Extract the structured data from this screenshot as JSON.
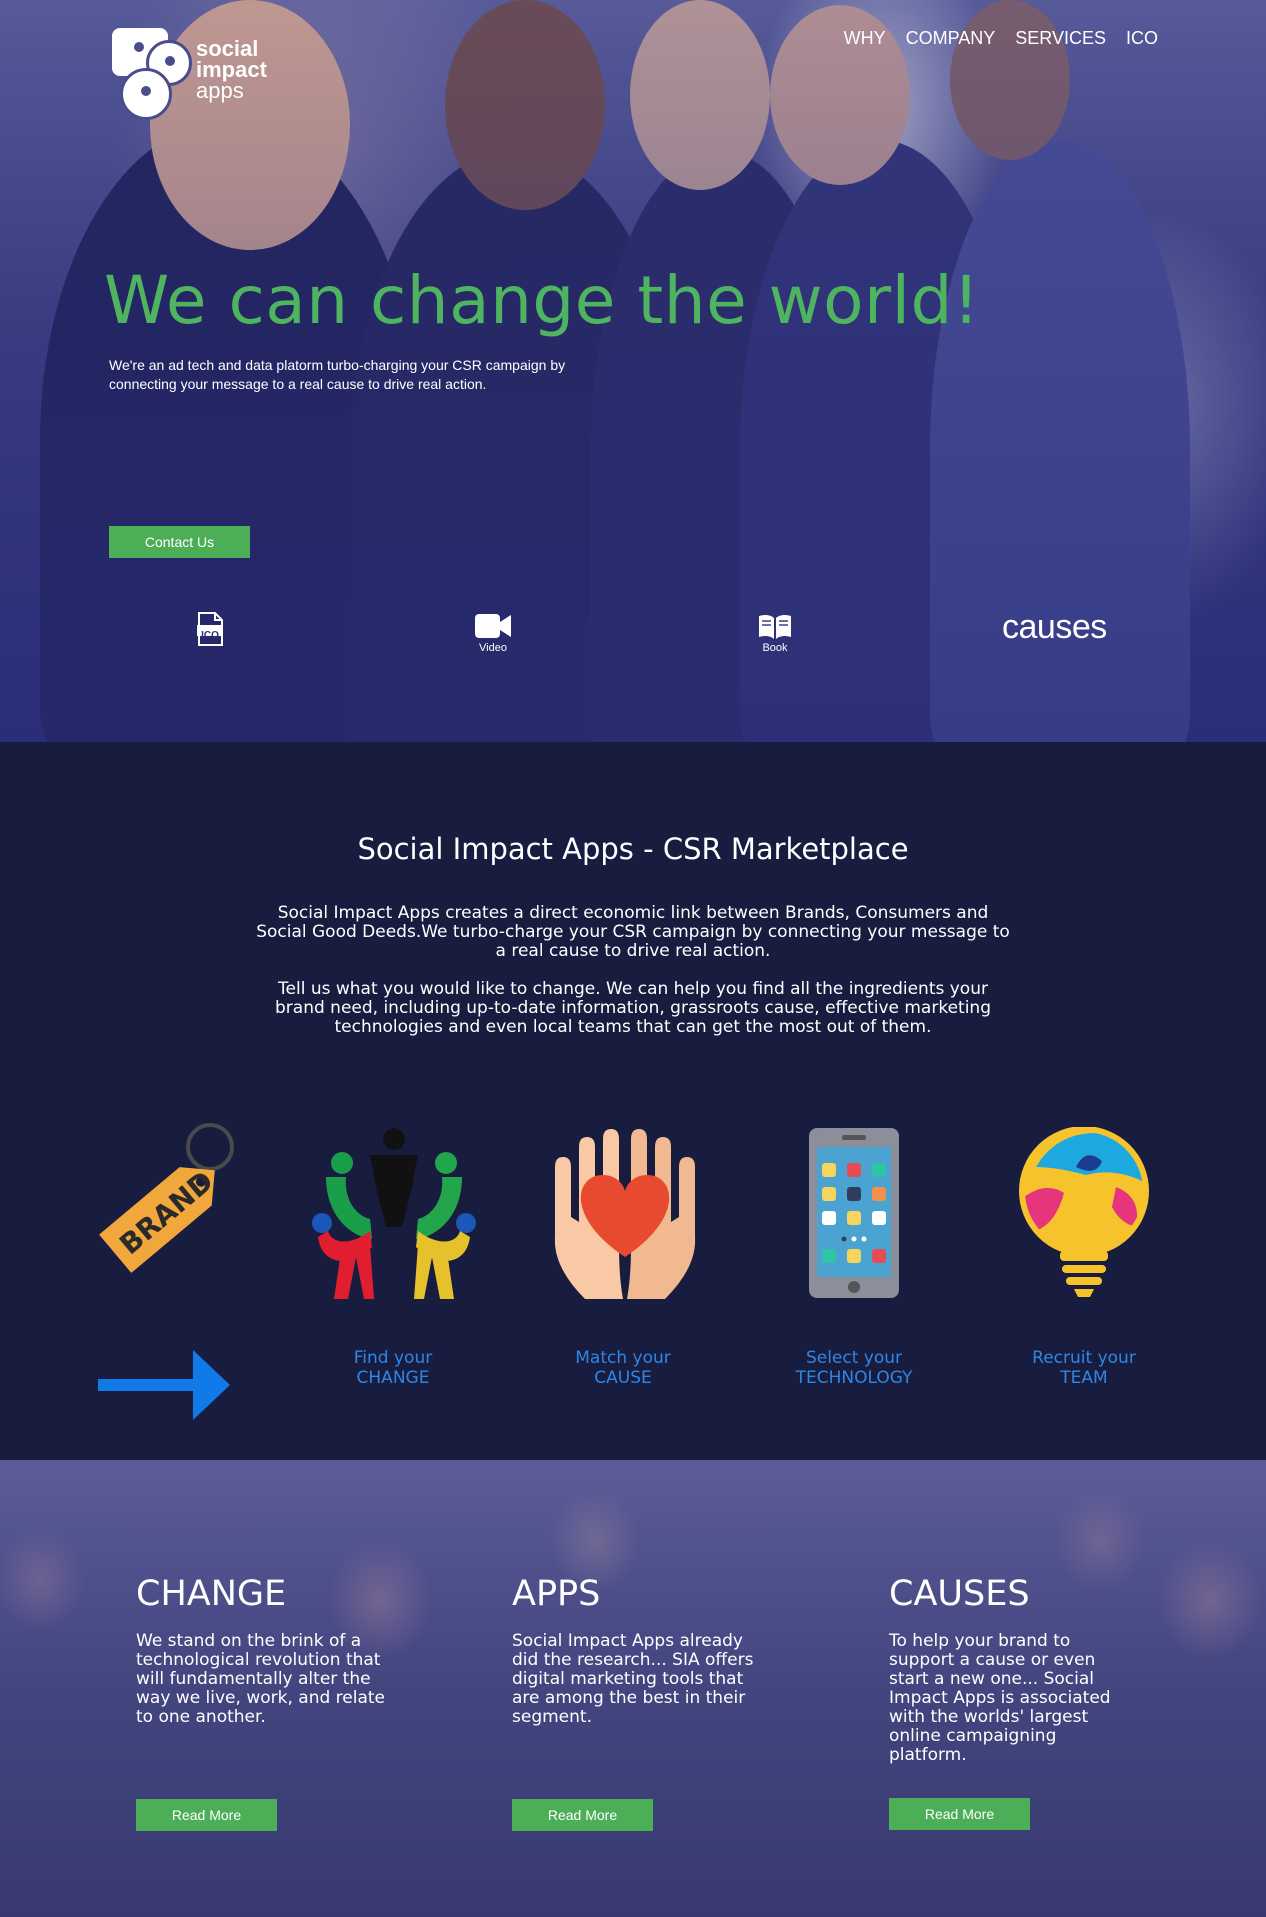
{
  "logo": {
    "line1": "social",
    "line2": "impact",
    "line3": "apps"
  },
  "nav": {
    "items": [
      "WHY",
      "COMPANY",
      "SERVICES",
      "ICO"
    ]
  },
  "hero": {
    "title": "We can change the world!",
    "lead": "We're an ad tech and data platorm turbo-charging your CSR campaign by connecting your message to a real cause to drive real action.",
    "contact_label": "Contact Us",
    "quick": {
      "ico_label": "ICO",
      "video_label": "Video",
      "book_label": "Book",
      "causes_word": "causes"
    }
  },
  "market": {
    "title": "Social Impact Apps - CSR Marketplace",
    "p1": "Social Impact Apps creates a direct economic link between Brands, Consumers and Social Good Deeds.We turbo-charge your CSR campaign by connecting your message to a real cause to drive real action.",
    "p2": "Tell us what you would like to change. We can help you find all the ingredients your brand need, including up-to-date information, grassroots cause, effective marketing technologies and even local teams that can get the most out of them.",
    "brand_tag": "BRAND",
    "steps": [
      {
        "line1": "Find your",
        "line2": "CHANGE",
        "icon": "people-circle-icon"
      },
      {
        "line1": "Match your",
        "line2": "CAUSE",
        "icon": "hands-heart-icon"
      },
      {
        "line1": "Select your",
        "line2": "TECHNOLOGY",
        "icon": "smartphone-icon"
      },
      {
        "line1": "Recruit your",
        "line2": "TEAM",
        "icon": "lightbulb-icon"
      }
    ],
    "colors": {
      "accent_blue": "#2f86e4",
      "background": "#181d40"
    }
  },
  "features": [
    {
      "title": "CHANGE",
      "text": "We stand on the brink of a technological revolution that will fundamentally alter the way we live, work, and relate to one another.",
      "button": "Read More"
    },
    {
      "title": "APPS",
      "text": "Social Impact Apps already did the research... SIA offers digital marketing tools that are among the best in their segment.",
      "button": "Read More"
    },
    {
      "title": "CAUSES",
      "text": "To help your brand to support a cause or even start a new one... Social Impact Apps is associated with the worlds' largest online campaigning platform.",
      "button": "Read More"
    }
  ],
  "colors": {
    "green": "#4caf58",
    "title_green": "#4fb45f"
  }
}
